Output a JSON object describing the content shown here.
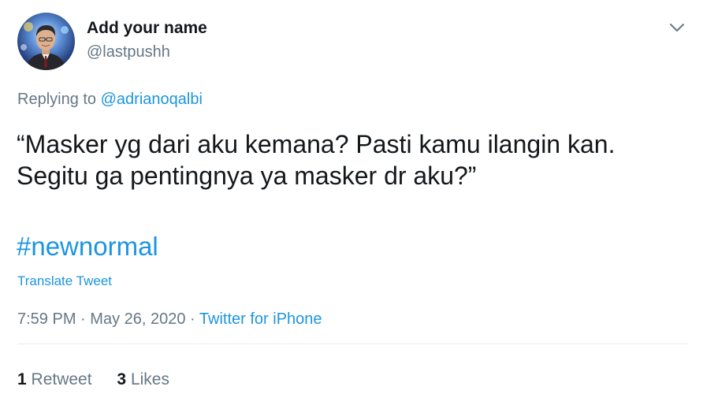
{
  "author": {
    "display_name": "Add your name",
    "handle": "@lastpushh",
    "avatar_icon": "profile-photo"
  },
  "header": {
    "menu_icon": "chevron-down-icon"
  },
  "reply": {
    "prefix": "Replying to",
    "mention": "@adrianoqalbi"
  },
  "tweet": {
    "text_lines": [
      "“Masker yg dari aku kemana? Pasti kamu ilangin kan.",
      "Segitu ga pentingnya ya masker dr aku?”"
    ],
    "hashtag": "#newnormal",
    "translate_label": "Translate Tweet"
  },
  "meta": {
    "time": "7:59 PM",
    "separator": "·",
    "date": "May 26, 2020",
    "source": "Twitter for iPhone"
  },
  "stats": {
    "retweets_count": "1",
    "retweets_label": "Retweet",
    "likes_count": "3",
    "likes_label": "Likes"
  },
  "colors": {
    "link": "#1b95e0",
    "secondary_text": "#657786",
    "primary_text": "#14171a",
    "divider": "#e6ecf0"
  }
}
